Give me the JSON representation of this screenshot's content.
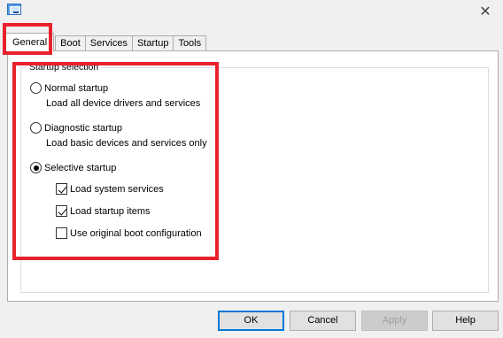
{
  "window": {
    "icon": "msconfig-window-icon",
    "close_glyph": "✕"
  },
  "tabs": [
    {
      "label": "General",
      "active": true
    },
    {
      "label": "Boot",
      "active": false
    },
    {
      "label": "Services",
      "active": false
    },
    {
      "label": "Startup",
      "active": false
    },
    {
      "label": "Tools",
      "active": false
    }
  ],
  "startup_selection": {
    "legend": "Startup selection",
    "normal": {
      "label": "Normal startup",
      "description": "Load all device drivers and services",
      "selected": false
    },
    "diagnostic": {
      "label": "Diagnostic startup",
      "description": "Load basic devices and services only",
      "selected": false
    },
    "selective": {
      "label": "Selective startup",
      "selected": true,
      "options": [
        {
          "label": "Load system services",
          "checked": true
        },
        {
          "label": "Load startup items",
          "checked": true
        },
        {
          "label": "Use original boot configuration",
          "checked": false
        }
      ]
    }
  },
  "buttons": {
    "ok": "OK",
    "cancel": "Cancel",
    "apply": "Apply",
    "help": "Help"
  },
  "colors": {
    "highlight": "#e8222d",
    "accent": "#0078d7"
  }
}
